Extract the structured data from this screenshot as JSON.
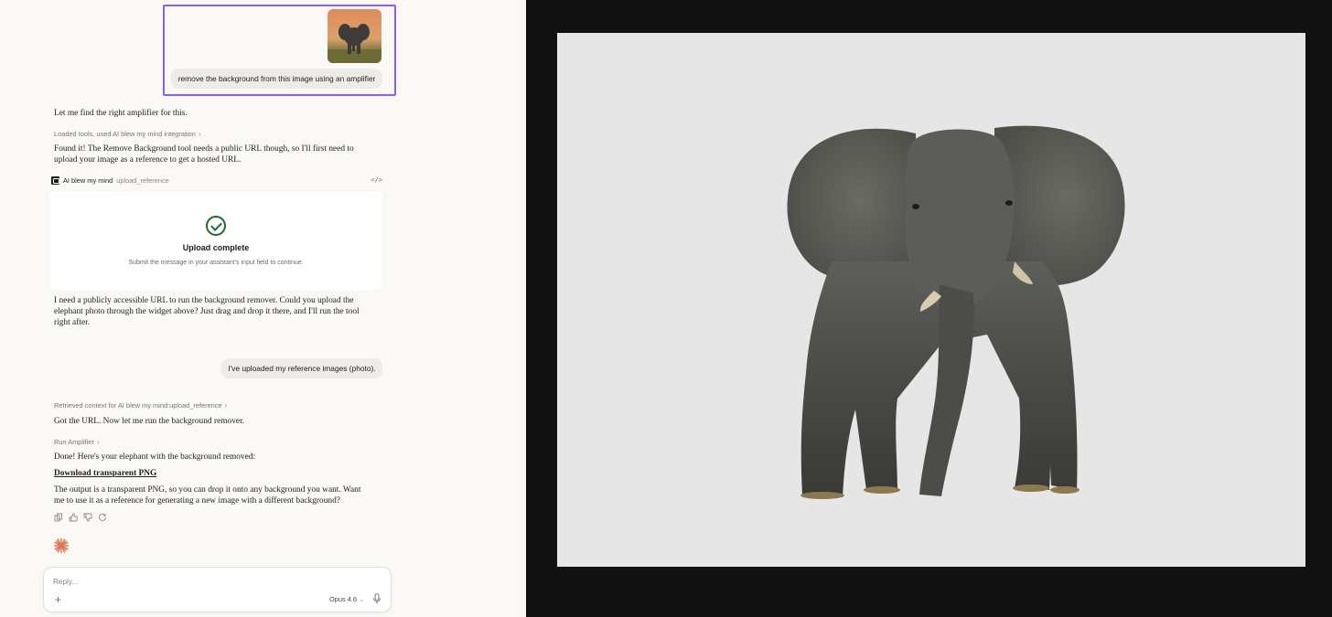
{
  "chat": {
    "user_message_1": "remove the background from this image using an amplifier",
    "assistant_1": "Let me find the right amplifier for this.",
    "tool_loaded": "Loaded tools, used AI blew my mind integration",
    "assistant_2": "Found it! The Remove Background tool needs a public URL though, so I'll first need to upload your image as a reference to get a hosted URL.",
    "tool_call": {
      "name": "AI blew my mind",
      "function": "upload_reference",
      "code_icon": "code-icon"
    },
    "upload_card": {
      "title": "Upload complete",
      "subtitle": "Submit the message in your assistant's input field to continue."
    },
    "assistant_3": "I need a publicly accessible URL to run the background remover. Could you upload the elephant photo through the widget above? Just drag and drop it there, and I'll run the tool right after.",
    "user_message_2": "I've uploaded my reference images (photo).",
    "context_retrieved": "Retrieved context for AI blew my mind:upload_reference",
    "assistant_4": "Got the URL. Now let me run the background remover.",
    "run_amplifier": "Run Amplifier",
    "assistant_5": "Done! Here's your elephant with the background removed:",
    "download_link": "Download transparent PNG",
    "assistant_6": "The output is a transparent PNG, so you can drop it onto any background you want. Want me to use it as a reference for generating a new image with a different background?",
    "actions": [
      "copy-icon",
      "thumbs-up-icon",
      "thumbs-down-icon",
      "retry-icon"
    ]
  },
  "composer": {
    "placeholder": "Reply...",
    "model": "Opus 4.6",
    "plus_label": "+"
  },
  "colors": {
    "highlight": "#8b5cf6",
    "success": "#1e6b2b",
    "spark": "#d97757",
    "chat_bg": "#faf9f5",
    "viewer_bg": "#111111",
    "canvas_bg": "#e6e6e6"
  }
}
